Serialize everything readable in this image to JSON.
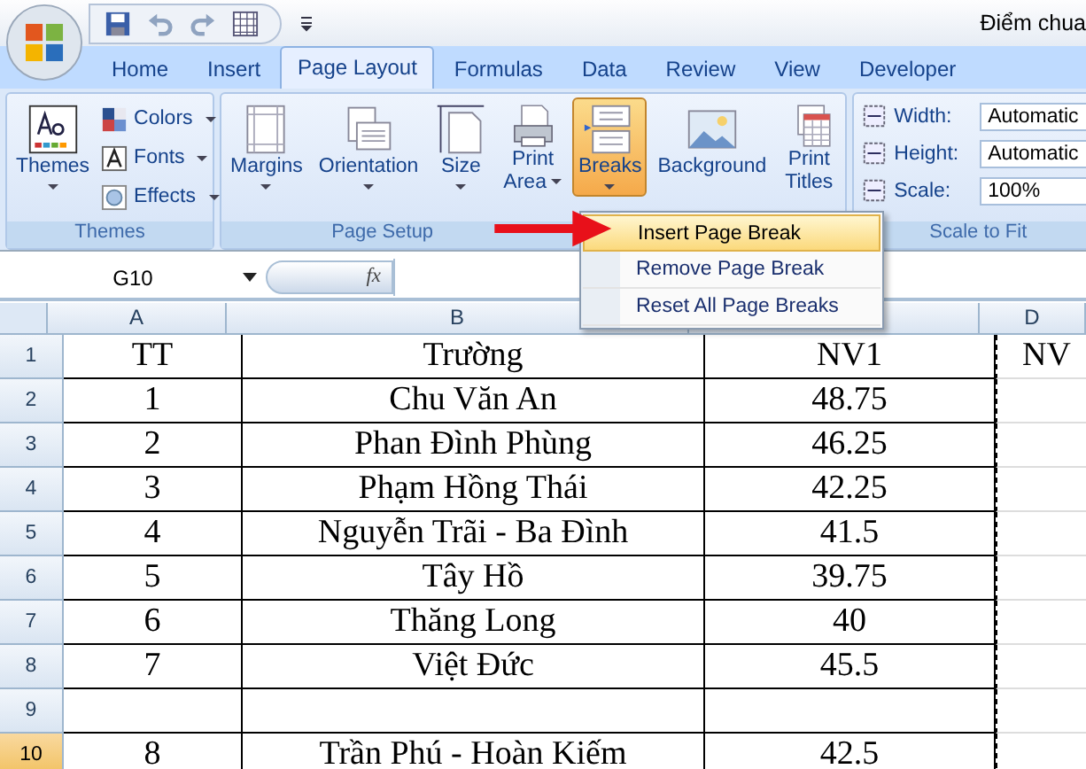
{
  "title_bar": {
    "title": "Điểm chua"
  },
  "tabs": [
    {
      "label": "Home",
      "selected": false
    },
    {
      "label": "Insert",
      "selected": false
    },
    {
      "label": "Page Layout",
      "selected": true
    },
    {
      "label": "Formulas",
      "selected": false
    },
    {
      "label": "Data",
      "selected": false
    },
    {
      "label": "Review",
      "selected": false
    },
    {
      "label": "View",
      "selected": false
    },
    {
      "label": "Developer",
      "selected": false
    }
  ],
  "ribbon": {
    "groups": [
      {
        "label": "Themes",
        "kind": "buttons",
        "items": [
          {
            "kind": "large",
            "lines": [
              "Themes"
            ],
            "dropdown": true,
            "pressed": false
          },
          {
            "kind": "small",
            "lines": [
              "Colors"
            ],
            "dropdown": true,
            "pressed": false
          },
          {
            "kind": "small",
            "lines": [
              "Fonts"
            ],
            "dropdown": true,
            "pressed": false
          },
          {
            "kind": "small",
            "lines": [
              "Effects"
            ],
            "dropdown": true,
            "pressed": false
          }
        ]
      },
      {
        "label": "Page Setup",
        "kind": "buttons",
        "items": [
          {
            "kind": "large",
            "lines": [
              "Margins"
            ],
            "dropdown": true,
            "pressed": false
          },
          {
            "kind": "large",
            "lines": [
              "Orientation"
            ],
            "dropdown": true,
            "pressed": false
          },
          {
            "kind": "large",
            "lines": [
              "Size"
            ],
            "dropdown": true,
            "pressed": false
          },
          {
            "kind": "large",
            "lines": [
              "Print",
              "Area"
            ],
            "dropdown": true,
            "pressed": false
          },
          {
            "kind": "large",
            "lines": [
              "Breaks"
            ],
            "dropdown": true,
            "pressed": true
          },
          {
            "kind": "large",
            "lines": [
              "Background"
            ],
            "dropdown": false,
            "pressed": false
          },
          {
            "kind": "large",
            "lines": [
              "Print",
              "Titles"
            ],
            "dropdown": false,
            "pressed": false
          }
        ]
      },
      {
        "label": "Scale to Fit",
        "kind": "fields",
        "items": [
          {
            "label": "Width:",
            "value": "Automatic"
          },
          {
            "label": "Height:",
            "value": "Automatic"
          },
          {
            "label": "Scale:",
            "value": "100%"
          }
        ]
      }
    ]
  },
  "formula_bar": {
    "name_box": "G10",
    "fx": "fx"
  },
  "breaks_menu": {
    "items": [
      {
        "label": "Insert Page Break",
        "selected": true
      },
      {
        "label": "Remove Page Break",
        "selected": false
      },
      {
        "label": "Reset All Page Breaks",
        "selected": false
      }
    ]
  },
  "sheet": {
    "columns": [
      {
        "label": "A"
      },
      {
        "label": "B"
      },
      {},
      {
        "label": "D"
      }
    ],
    "rows": [
      {
        "number": "1",
        "selected": false,
        "cells": [
          "TT",
          "Trường",
          "NV1",
          "NV"
        ]
      },
      {
        "number": "2",
        "selected": false,
        "cells": [
          "1",
          "Chu Văn An",
          "48.75"
        ]
      },
      {
        "number": "3",
        "selected": false,
        "cells": [
          "2",
          "Phan Đình Phùng",
          "46.25"
        ]
      },
      {
        "number": "4",
        "selected": false,
        "cells": [
          "3",
          "Phạm Hồng Thái",
          "42.25"
        ]
      },
      {
        "number": "5",
        "selected": false,
        "cells": [
          "4",
          "Nguyễn Trãi - Ba Đình",
          "41.5"
        ]
      },
      {
        "number": "6",
        "selected": false,
        "cells": [
          "5",
          "Tây Hồ",
          "39.75"
        ]
      },
      {
        "number": "7",
        "selected": false,
        "cells": [
          "6",
          "Thăng Long",
          "40"
        ]
      },
      {
        "number": "8",
        "selected": false,
        "cells": [
          "7",
          "Việt Đức",
          "45.5"
        ]
      },
      {
        "number": "9",
        "selected": false,
        "cells": []
      },
      {
        "number": "10",
        "selected": true,
        "cells": [
          "8",
          "Trần Phú - Hoàn Kiếm",
          "42.5"
        ]
      }
    ]
  }
}
